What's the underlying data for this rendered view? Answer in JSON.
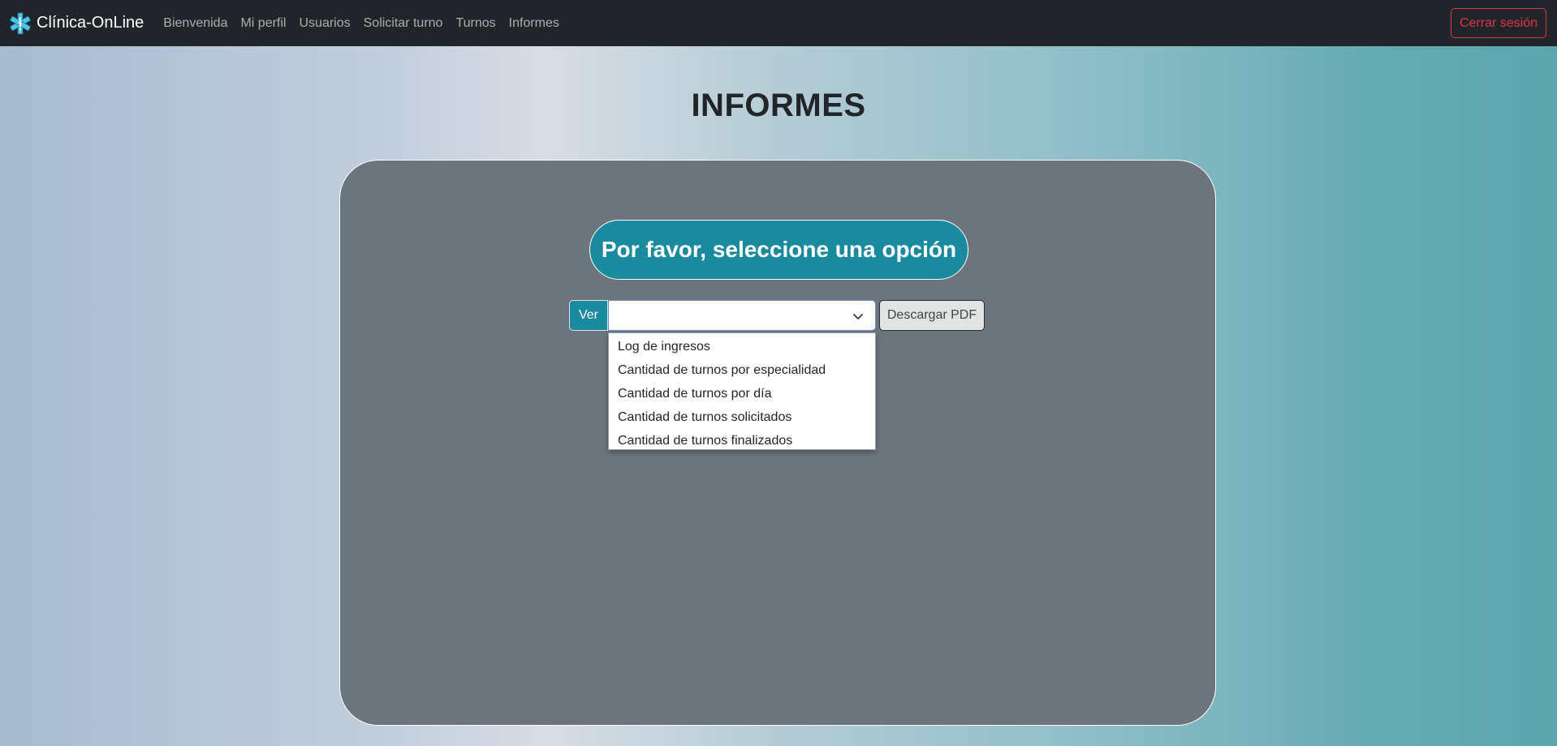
{
  "navbar": {
    "brand": "Clínica-OnLine",
    "links": [
      "Bienvenida",
      "Mi perfil",
      "Usuarios",
      "Solicitar turno",
      "Turnos",
      "Informes"
    ],
    "logout_label": "Cerrar sesión"
  },
  "page": {
    "title": "INFORMES"
  },
  "panel": {
    "prompt": "Por favor, seleccione una opción",
    "ver_label": "Ver",
    "select_value": "",
    "pdf_button": "Descargar PDF",
    "options": [
      "Log de ingresos",
      "Cantidad de turnos por especialidad",
      "Cantidad de turnos por día",
      "Cantidad de turnos solicitados",
      "Cantidad de turnos finalizados"
    ]
  },
  "icons": {
    "brand": "medical-star-of-life-icon",
    "select": "chevron-down-icon"
  },
  "colors": {
    "navbar": "#212529",
    "accent": "#1a8a9e",
    "panel": "#6c757d",
    "danger": "#dc3545"
  }
}
